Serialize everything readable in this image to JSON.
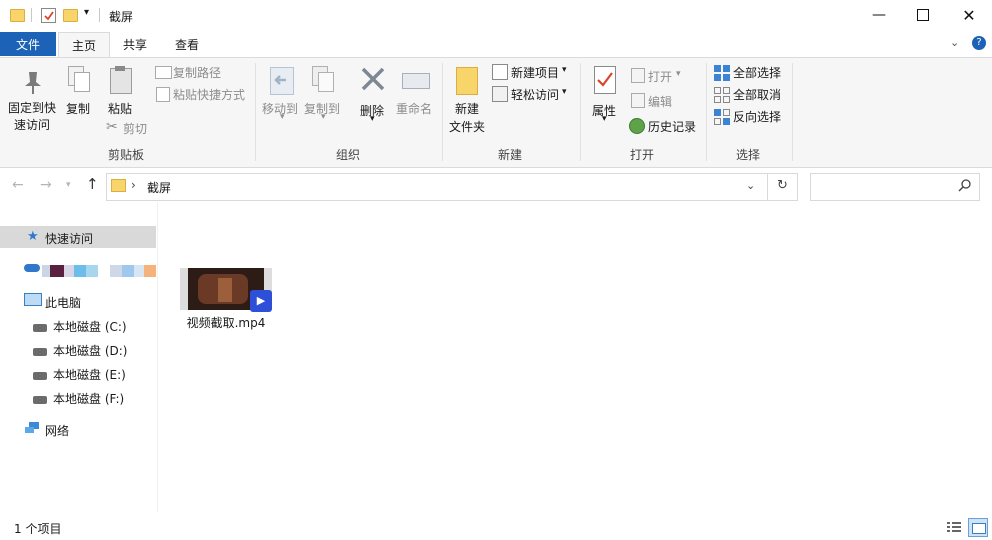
{
  "window": {
    "title": "截屏"
  },
  "tabs": {
    "file": "文件",
    "home": "主页",
    "share": "共享",
    "view": "查看"
  },
  "ribbon": {
    "clipboard": {
      "pin": "固定到快\n速访问",
      "pin_line1": "固定到快",
      "pin_line2": "速访问",
      "copy": "复制",
      "paste": "粘贴",
      "copy_path": "复制路径",
      "paste_shortcut": "粘贴快捷方式",
      "cut": "剪切",
      "group": "剪贴板"
    },
    "organize": {
      "move_to": "移动到",
      "copy_to": "复制到",
      "delete": "删除",
      "rename": "重命名",
      "group": "组织"
    },
    "new": {
      "new_folder_line1": "新建",
      "new_folder_line2": "文件夹",
      "new_item": "新建项目",
      "easy_access": "轻松访问",
      "group": "新建"
    },
    "open": {
      "properties": "属性",
      "open": "打开",
      "edit": "编辑",
      "history": "历史记录",
      "group": "打开"
    },
    "select": {
      "select_all": "全部选择",
      "select_none": "全部取消",
      "invert": "反向选择",
      "group": "选择"
    }
  },
  "address": {
    "path": "截屏"
  },
  "nav": {
    "quick_access": "快速访问",
    "this_pc": "此电脑",
    "drives": [
      "本地磁盘 (C:)",
      "本地磁盘 (D:)",
      "本地磁盘 (E:)",
      "本地磁盘 (F:)"
    ],
    "network": "网络"
  },
  "files": [
    {
      "name": "视频截取.mp4"
    }
  ],
  "status": {
    "count": "1 个项目"
  },
  "colors": {
    "accent": "#1c62b7",
    "folder": "#f8d56b"
  }
}
